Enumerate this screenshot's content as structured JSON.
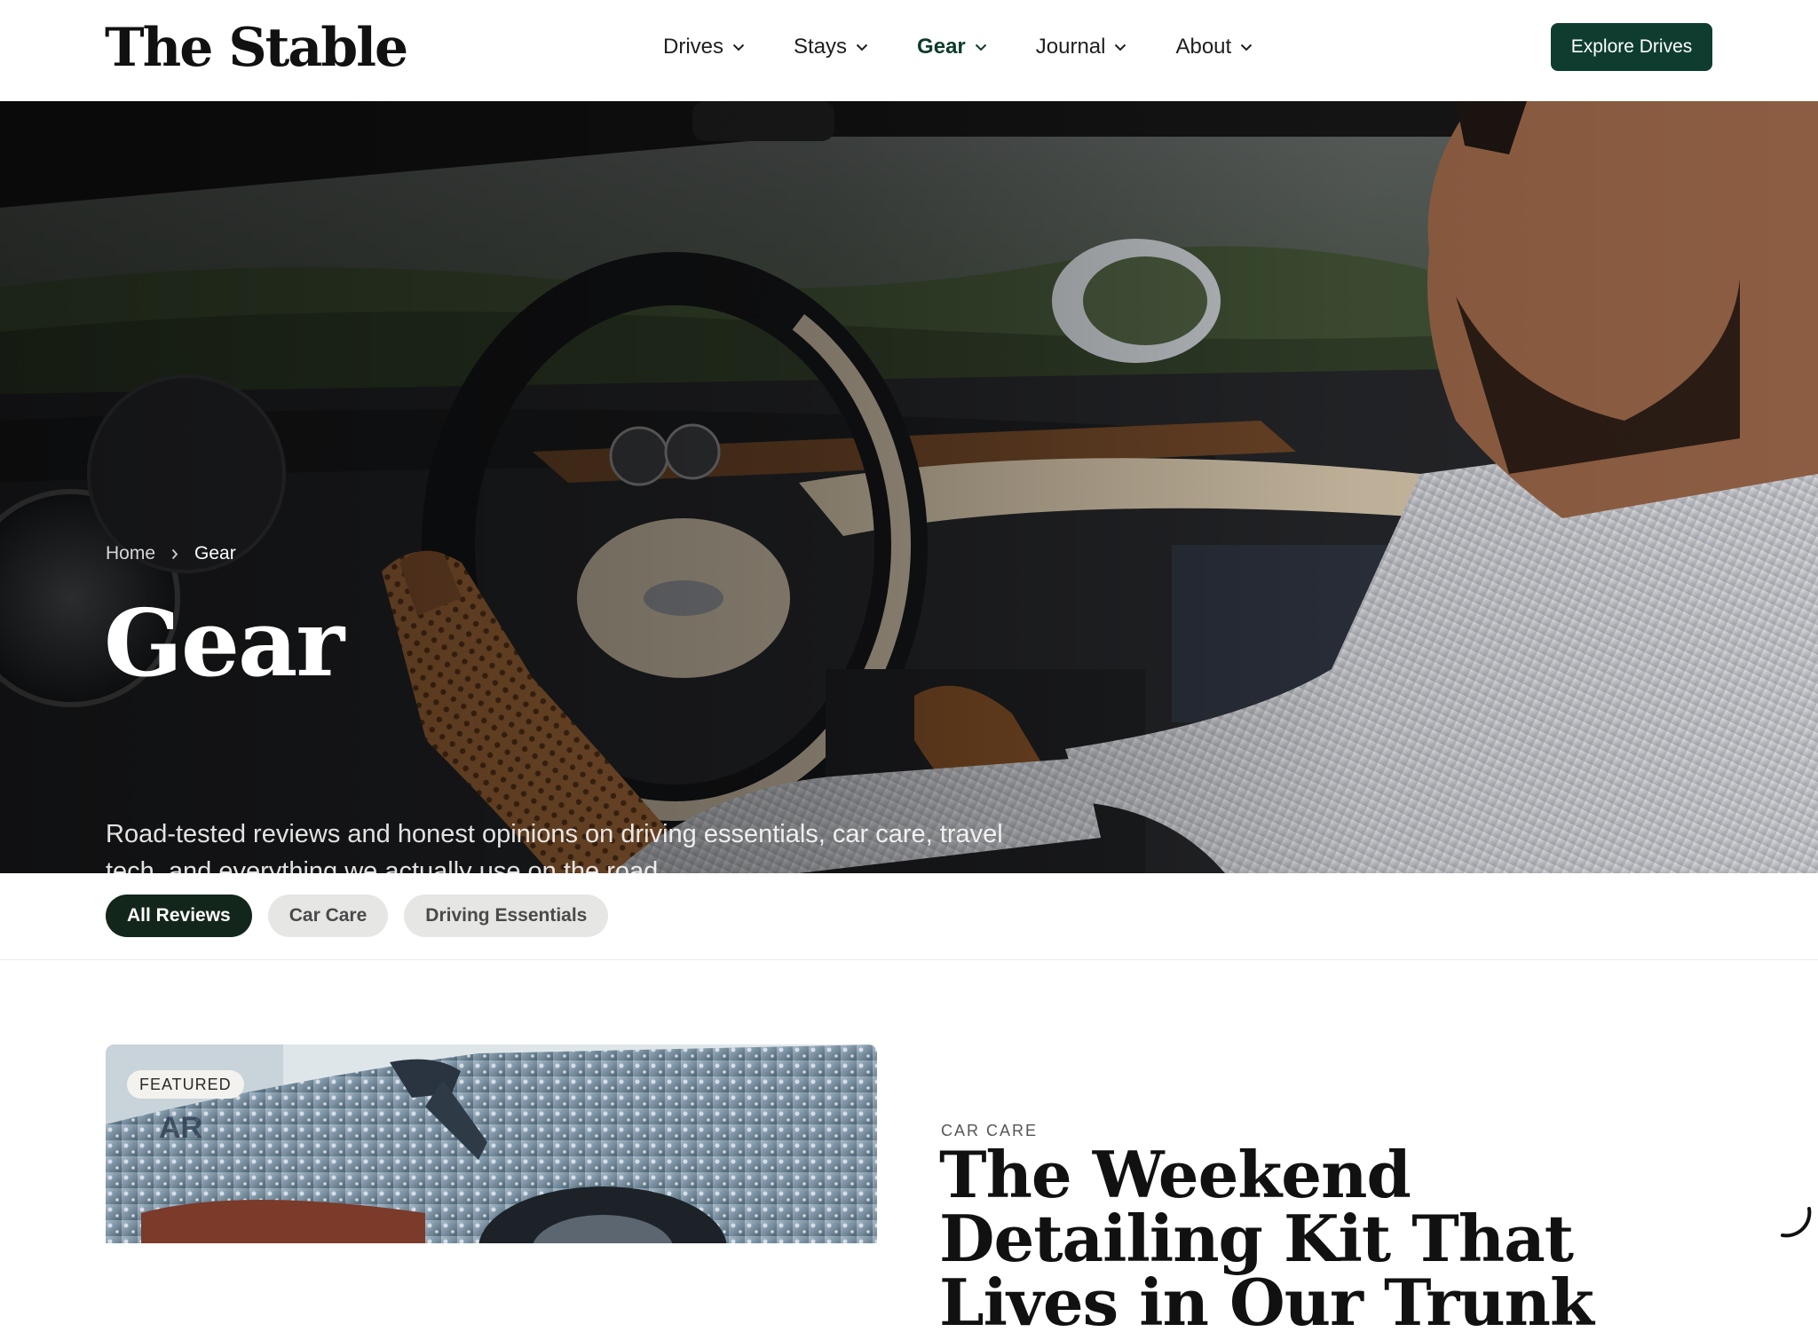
{
  "header": {
    "logo": "The Stable",
    "nav": [
      {
        "label": "Drives"
      },
      {
        "label": "Stays"
      },
      {
        "label": "Gear",
        "active": true
      },
      {
        "label": "Journal"
      },
      {
        "label": "About"
      }
    ],
    "cta_label": "Explore Drives"
  },
  "hero": {
    "breadcrumb": {
      "home": "Home",
      "current": "Gear"
    },
    "title": "Gear",
    "description": "Road-tested reviews and honest opinions on driving essentials, car care, travel tech, and everything we actually use on the road."
  },
  "filters": [
    {
      "label": "All Reviews",
      "active": true
    },
    {
      "label": "Car Care"
    },
    {
      "label": "Driving Essentials"
    }
  ],
  "featured": {
    "badge": "FEATURED",
    "category": "CAR CARE",
    "title": "The Weekend Detailing Kit That Lives in Our Trunk"
  },
  "colors": {
    "brand_green": "#0e3d30",
    "active_pill": "#13261b",
    "inactive_pill": "#e6e6e4"
  },
  "icons": [
    "chevron-down-icon",
    "chevron-right-icon",
    "loading-spinner-icon"
  ]
}
